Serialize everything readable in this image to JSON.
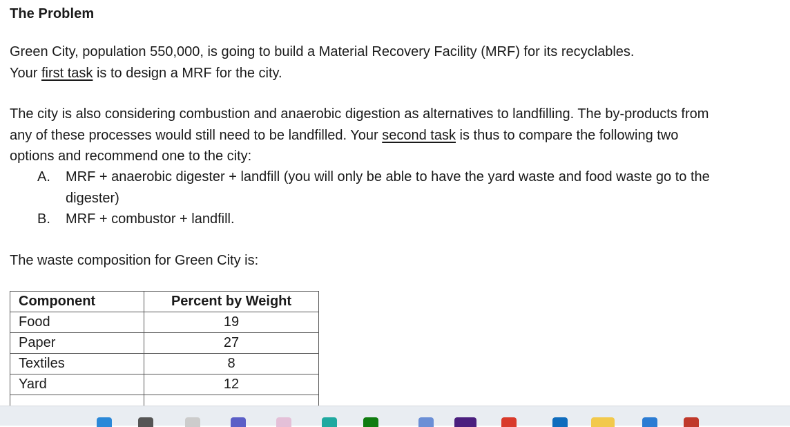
{
  "heading": "The Problem",
  "paragraph1": {
    "line1": "Green City, population 550,000, is going to build a Material Recovery Facility (MRF) for its recyclables.",
    "line2_pre": "Your ",
    "line2_underlined": "first task",
    "line2_post": " is to design a MRF for the city."
  },
  "paragraph2": {
    "text_pre": "The city is also considering combustion and anaerobic digestion as alternatives to landfilling. The by-products from any of these processes would still need to be landfilled. Your ",
    "underlined": "second task",
    "text_post": " is thus to compare the following two options and recommend one to the city:"
  },
  "options": [
    {
      "marker": "A.",
      "text": "MRF + anaerobic digester + landfill (you will only be able to have the yard waste and food waste go to the digester)"
    },
    {
      "marker": "B.",
      "text": "MRF + combustor + landfill."
    }
  ],
  "paragraph3": "The waste composition for Green City is:",
  "table": {
    "headers": [
      "Component",
      "Percent by Weight"
    ],
    "rows": [
      {
        "component": "Food",
        "percent": "19"
      },
      {
        "component": "Paper",
        "percent": "27"
      },
      {
        "component": "Textiles",
        "percent": "8"
      },
      {
        "component": "Yard",
        "percent": "12"
      }
    ]
  },
  "taskbar": {
    "icons": [
      {
        "name": "windows-start-icon",
        "color": "#2b88d8"
      },
      {
        "name": "search-icon",
        "color": "#555555"
      },
      {
        "name": "task-view-icon",
        "color": "#cccccc"
      },
      {
        "name": "teams-icon",
        "color": "#5b5fc7"
      },
      {
        "name": "app-icon",
        "color": "#e4c0d8"
      },
      {
        "name": "edge-icon",
        "color": "#1fa9a0"
      },
      {
        "name": "xbox-icon",
        "color": "#107c10"
      },
      {
        "name": "people-icon",
        "color": "#6b8fd6"
      },
      {
        "name": "onenote-icon",
        "color": "#4b1f7e"
      },
      {
        "name": "chrome-icon",
        "color": "#d93a2b"
      },
      {
        "name": "outlook-icon",
        "color": "#0f6cbd"
      },
      {
        "name": "file-explorer-icon",
        "color": "#f2c94c"
      },
      {
        "name": "word-icon",
        "color": "#2b7cd3"
      },
      {
        "name": "calendar-icon",
        "color": "#c0392b"
      }
    ]
  }
}
